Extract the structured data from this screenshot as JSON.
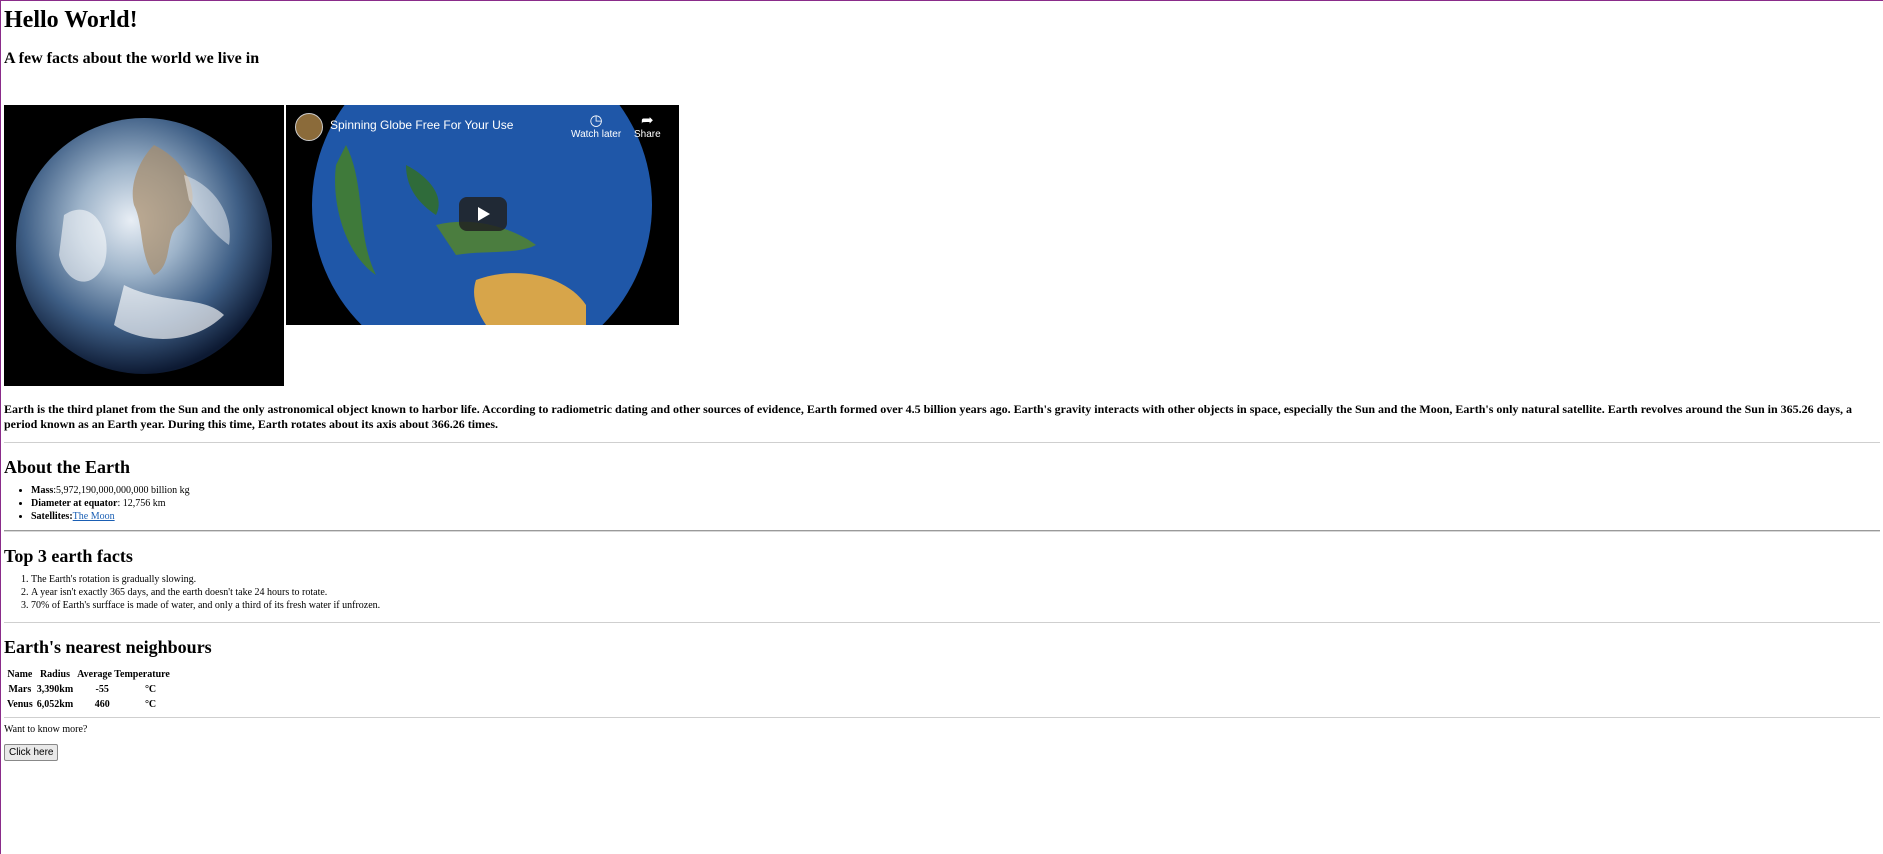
{
  "header": {
    "title": "Hello World!",
    "subtitle": "A few facts about the world we live in"
  },
  "media": {
    "image_alt": "Earth",
    "video": {
      "title": "Spinning Globe Free For Your Use",
      "watch_later": "Watch later",
      "share": "Share"
    }
  },
  "intro": "Earth is the third planet from the Sun and the only astronomical object known to harbor life. According to radiometric dating and other sources of evidence, Earth formed over 4.5 billion years ago. Earth's gravity interacts with other objects in space, especially the Sun and the Moon, Earth's only natural satellite. Earth revolves around the Sun in 365.26 days, a period known as an Earth year. During this time, Earth rotates about its axis about 366.26 times.",
  "about": {
    "heading": "About the Earth",
    "mass_label": "Mass",
    "mass_value": ":5,972,190,000,000,000 billion kg",
    "diameter_label": "Diameter at equator",
    "diameter_value": ": 12,756 km",
    "satellites_label": "Satellites",
    "satellites_sep": ":",
    "satellites_link": "The Moon"
  },
  "facts": {
    "heading": "Top 3 earth facts",
    "items": [
      "The Earth's rotation is gradually slowing.",
      "A year isn't exactly 365 days, and the earth doesn't take 24 hours to rotate.",
      "70% of Earth's surfface is made of water, and only a third of its fresh water if unfrozen."
    ]
  },
  "neighbours": {
    "heading": "Earth's nearest neighbours",
    "columns": [
      "Name",
      "Radius",
      "Average Temperature"
    ],
    "rows": [
      [
        "Mars",
        "3,390km",
        "-55",
        "°C"
      ],
      [
        "Venus",
        "6,052km",
        "460",
        "°C"
      ]
    ]
  },
  "footer": {
    "more": "Want to know more?",
    "button": "Click here"
  }
}
